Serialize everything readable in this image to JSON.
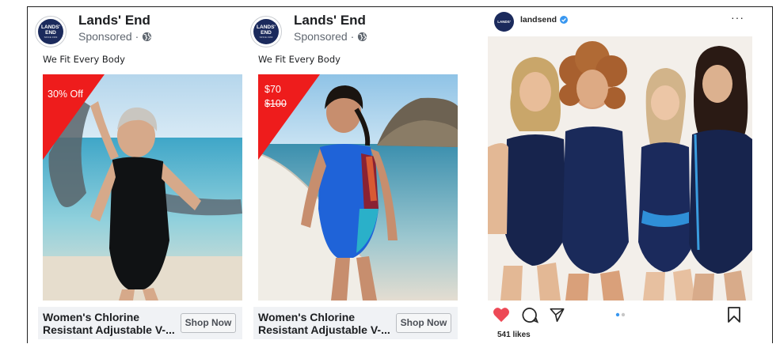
{
  "ads": [
    {
      "brand": "Lands' End",
      "sponsored": "Sponsored ·",
      "caption": "We Fit Every Body",
      "badge": "30% Off",
      "product": "Women's Chlorine Resistant Adjustable V-...",
      "cta": "Shop Now"
    },
    {
      "brand": "Lands' End",
      "sponsored": "Sponsored ·",
      "caption": "We Fit Every Body",
      "badge_price": "$70",
      "badge_old_price": "$100",
      "product": "Women's Chlorine Resistant Adjustable V-...",
      "cta": "Shop Now"
    }
  ],
  "logo": {
    "line1": "LANDS'",
    "line2": "END",
    "tag": "SINCE 1963"
  },
  "instagram": {
    "username": "landsend",
    "more": "···",
    "likes": "541 likes",
    "icons": [
      "heart-icon",
      "comment-icon",
      "share-icon",
      "bookmark-icon"
    ],
    "carousel_dots": 2,
    "active_dot": 0
  },
  "colors": {
    "badge_red": "#ee1c1c",
    "navy": "#1b2a5c",
    "like_red": "#ed4956",
    "verified_blue": "#3897f0"
  }
}
